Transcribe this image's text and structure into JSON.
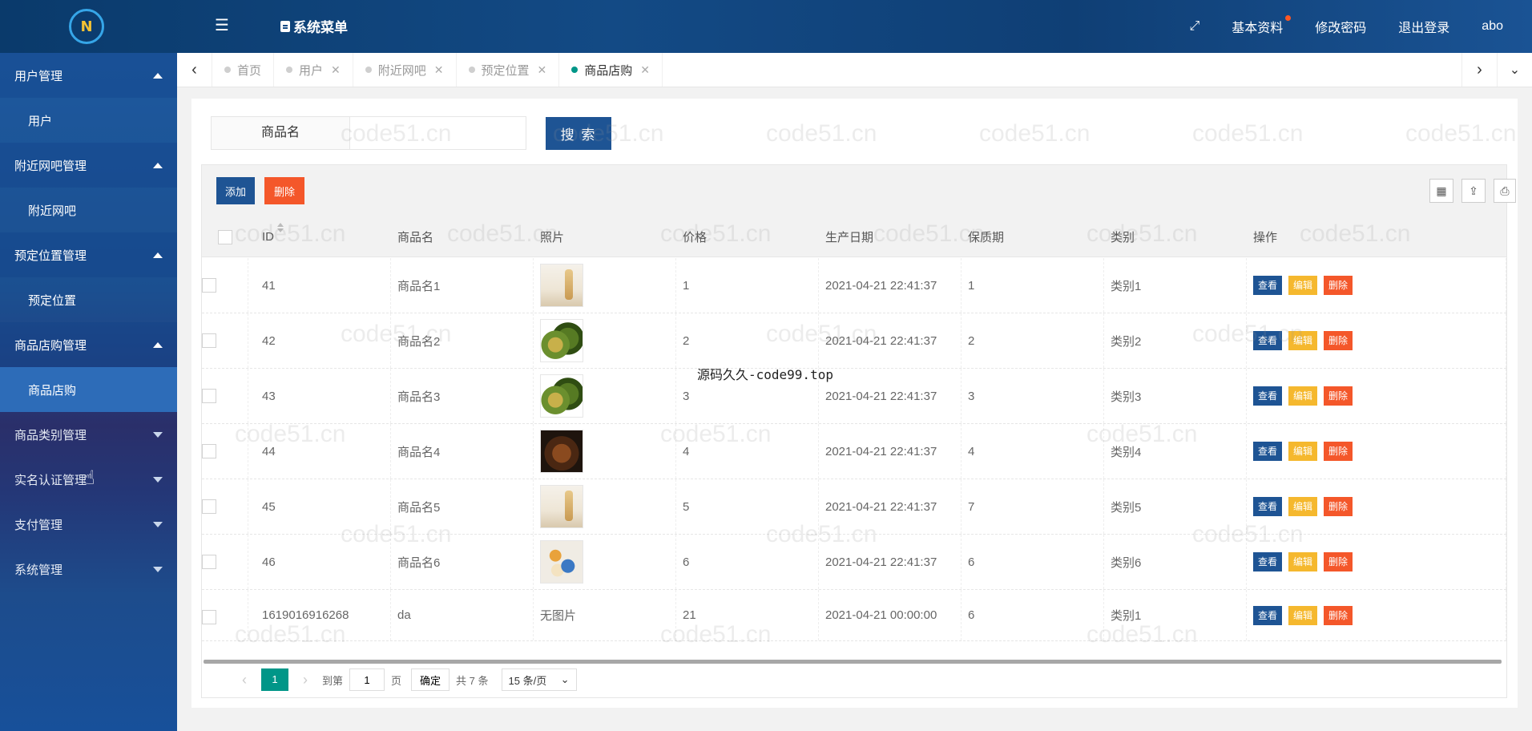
{
  "header": {
    "logo_text": "N",
    "menu_title": "系统菜单",
    "basic_info": "基本资料",
    "change_password": "修改密码",
    "logout": "退出登录",
    "username": "abo"
  },
  "sidebar": {
    "groups": [
      {
        "title": "用户管理",
        "state": "open",
        "items": [
          "用户"
        ]
      },
      {
        "title": "附近网吧管理",
        "state": "open",
        "items": [
          "附近网吧"
        ]
      },
      {
        "title": "预定位置管理",
        "state": "open",
        "items": [
          "预定位置"
        ]
      },
      {
        "title": "商品店购管理",
        "state": "open",
        "items": [
          "商品店购"
        ]
      },
      {
        "title": "商品类别管理",
        "state": "closed"
      },
      {
        "title": "实名认证管理",
        "state": "closed"
      },
      {
        "title": "支付管理",
        "state": "closed"
      },
      {
        "title": "系统管理",
        "state": "closed"
      }
    ]
  },
  "tabs": [
    "首页",
    "用户",
    "附近网吧",
    "预定位置",
    "商品店购"
  ],
  "active_tab": "商品店购",
  "search": {
    "label": "商品名",
    "value": "",
    "button": "搜 索"
  },
  "toolbar": {
    "add": "添加",
    "delete": "删除"
  },
  "table": {
    "headers": [
      "ID",
      "商品名",
      "照片",
      "价格",
      "生产日期",
      "保质期",
      "类别",
      "操作"
    ],
    "rows": [
      {
        "id": "41",
        "name": "商品名1",
        "photo": "poster",
        "price": "1",
        "date": "2021-04-21 22:41:37",
        "shelf": "1",
        "cat": "类别1"
      },
      {
        "id": "42",
        "name": "商品名2",
        "photo": "avocado",
        "price": "2",
        "date": "2021-04-21 22:41:37",
        "shelf": "2",
        "cat": "类别2"
      },
      {
        "id": "43",
        "name": "商品名3",
        "photo": "avocado",
        "price": "3",
        "date": "2021-04-21 22:41:37",
        "shelf": "3",
        "cat": "类别3"
      },
      {
        "id": "44",
        "name": "商品名4",
        "photo": "food",
        "price": "4",
        "date": "2021-04-21 22:41:37",
        "shelf": "4",
        "cat": "类别4"
      },
      {
        "id": "45",
        "name": "商品名5",
        "photo": "poster",
        "price": "5",
        "date": "2021-04-21 22:41:37",
        "shelf": "7",
        "cat": "类别5"
      },
      {
        "id": "46",
        "name": "商品名6",
        "photo": "bowl",
        "price": "6",
        "date": "2021-04-21 22:41:37",
        "shelf": "6",
        "cat": "类别6"
      },
      {
        "id": "1619016916268",
        "name": "da",
        "photo": "none",
        "photo_text": "无图片",
        "price": "21",
        "date": "2021-04-21 00:00:00",
        "shelf": "6",
        "cat": "类别1"
      }
    ],
    "ops": {
      "view": "查看",
      "edit": "编辑",
      "delete": "删除"
    }
  },
  "pager": {
    "current": "1",
    "goto_label": "到第",
    "page_input": "1",
    "page_unit": "页",
    "confirm": "确定",
    "total": "共 7 条",
    "page_size": "15 条/页"
  },
  "watermarks": {
    "site": "code51.cn",
    "overlay": "源码久久-code99.top"
  }
}
